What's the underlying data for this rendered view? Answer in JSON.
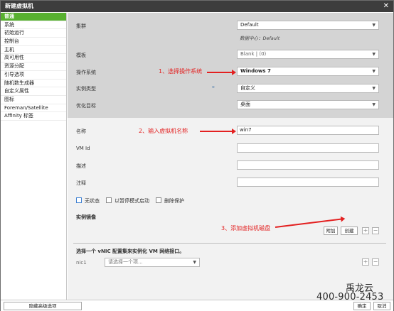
{
  "window": {
    "title": "新建虚拟机",
    "close_glyph": "✕"
  },
  "sidebar": {
    "items": [
      {
        "label": "普通",
        "active": true
      },
      {
        "label": "系统"
      },
      {
        "label": "初始运行"
      },
      {
        "label": "控制台"
      },
      {
        "label": "主机"
      },
      {
        "label": "高可用性"
      },
      {
        "label": "资源分配"
      },
      {
        "label": "引导选项"
      },
      {
        "label": "随机数生成器"
      },
      {
        "label": "自定义属性"
      },
      {
        "label": "图标"
      },
      {
        "label": "Foreman/Satellite"
      },
      {
        "label": "Affinity 标签"
      }
    ]
  },
  "form": {
    "cluster_label": "集群",
    "cluster_value": "Default",
    "datacenter_hint": "数据中心：Default",
    "template_label": "模板",
    "template_value": "Blank | (0)",
    "os_label": "操作系统",
    "os_value": "Windows 7",
    "instance_type_label": "实例类型",
    "instance_type_value": "自定义",
    "optimize_label": "优化目标",
    "optimize_value": "桌面",
    "name_label": "名称",
    "name_value": "win7",
    "vmid_label": "VM Id",
    "desc_label": "描述",
    "comment_label": "注释",
    "stateless_label": "无状态",
    "pause_label": "以暂停模式启动",
    "delete_protect_label": "删除保护",
    "instance_images_label": "实例镜像",
    "attach_button": "附加",
    "create_button": "创建",
    "vnic_heading": "选择一个 vNIC 配置集来实例化 VM 网络接口。",
    "nic1_label": "nic1",
    "nic1_placeholder": "请选择一个项..."
  },
  "annotations": {
    "step1": "1、选择操作系统",
    "step2": "2、输入虚拟机名称",
    "step3": "3、添加虚拟机磁盘",
    "color": "#e32020"
  },
  "footer": {
    "advanced_button": "隐藏高级选项",
    "ok_button": "确定",
    "cancel_button": "取消"
  },
  "watermark": {
    "line1": "禹龙云",
    "line2": "400-900-2453"
  }
}
